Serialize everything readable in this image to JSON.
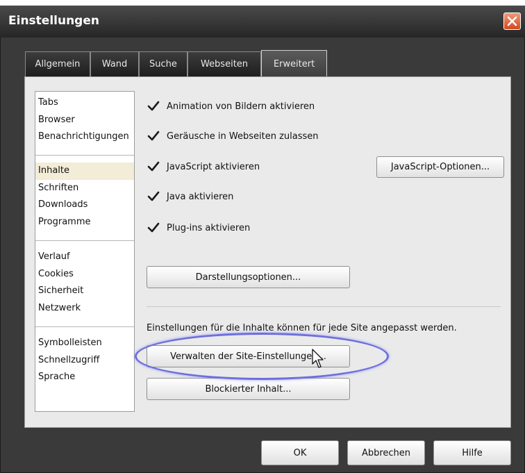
{
  "window": {
    "title": "Einstellungen"
  },
  "tabs": [
    {
      "label": "Allgemein"
    },
    {
      "label": "Wand"
    },
    {
      "label": "Suche"
    },
    {
      "label": "Webseiten"
    },
    {
      "label": "Erweitert",
      "active": true
    }
  ],
  "sidebar": {
    "groups": [
      [
        "Tabs",
        "Browser",
        "Benachrichtigungen"
      ],
      [
        "Inhalte",
        "Schriften",
        "Downloads",
        "Programme"
      ],
      [
        "Verlauf",
        "Cookies",
        "Sicherheit",
        "Netzwerk"
      ],
      [
        "Symbolleisten",
        "Schnellzugriff",
        "Sprache"
      ]
    ],
    "selected": "Inhalte"
  },
  "options": {
    "animation": {
      "label": "Animation von Bildern aktivieren",
      "checked": true
    },
    "sounds": {
      "label": "Geräusche in Webseiten zulassen",
      "checked": true
    },
    "javascript": {
      "label": "JavaScript aktivieren",
      "checked": true
    },
    "java": {
      "label": "Java aktivieren",
      "checked": true
    },
    "plugins": {
      "label": "Plug-ins aktivieren",
      "checked": true
    }
  },
  "buttons": {
    "js_options": "JavaScript-Optionen...",
    "display_options": "Darstellungsoptionen...",
    "manage_site": "Verwalten der Site-Einstellungen...",
    "blocked_content": "Blockierter Inhalt...",
    "ok": "OK",
    "cancel": "Abbrechen",
    "help": "Hilfe"
  },
  "info": {
    "site_text": "Einstellungen für die Inhalte können für jede Site angepasst werden."
  },
  "colors": {
    "window_bg": "#3a3a3a",
    "panel_bg": "#eaeaea",
    "close_button": "#d2481f",
    "highlight": "#6f6fdc",
    "selected_item": "#f3ecd6"
  },
  "icons": {
    "close": "close-icon",
    "checkbox": "checkmark-icon",
    "cursor": "mouse-pointer-icon"
  }
}
